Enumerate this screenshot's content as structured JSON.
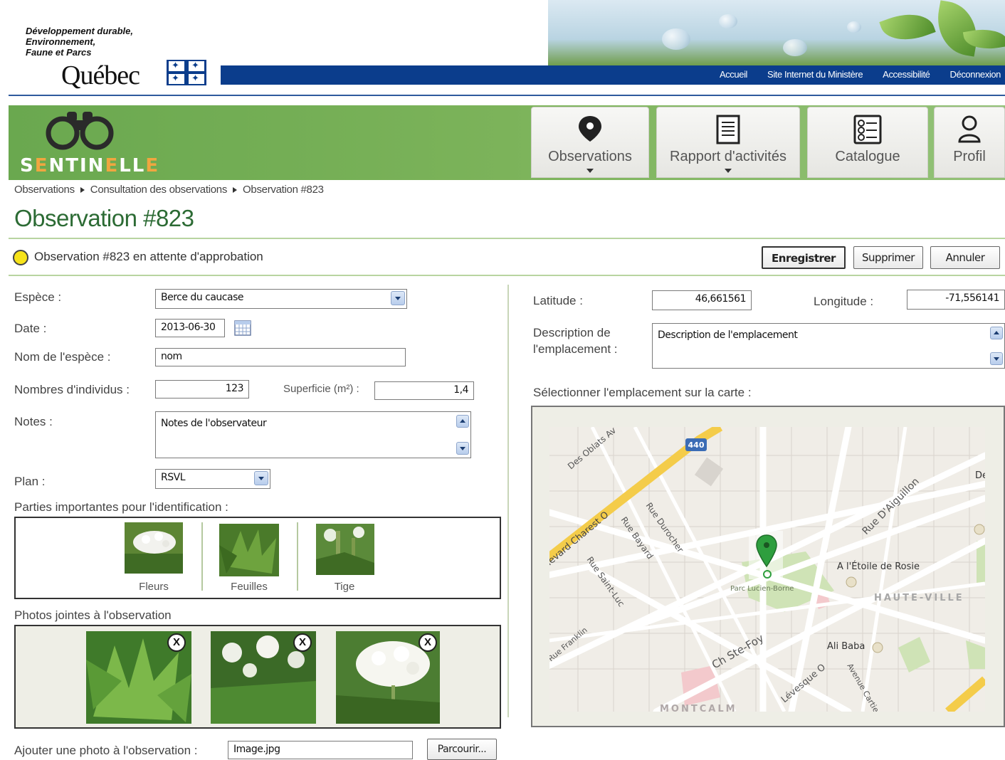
{
  "header": {
    "ministry_lines": [
      "Développement durable,",
      "Environnement,",
      "Faune et Parcs"
    ],
    "government": "Québec",
    "links": [
      "Accueil",
      "Site Internet du Ministère",
      "Accessibilité",
      "Déconnexion"
    ]
  },
  "brand": {
    "prefix": "S",
    "highlight1": "E",
    "mid": "NTIN",
    "highlight2": "E",
    "suffix": "LL",
    "last": "E"
  },
  "nav": [
    {
      "label": "Observations",
      "icon": "map-pin-icon",
      "has_dropdown": true
    },
    {
      "label": "Rapport d'activités",
      "icon": "document-icon",
      "has_dropdown": true
    },
    {
      "label": "Catalogue",
      "icon": "catalogue-icon",
      "has_dropdown": false
    },
    {
      "label": "Profil",
      "icon": "user-icon",
      "has_dropdown": false
    }
  ],
  "breadcrumb": [
    "Observations",
    "Consultation des observations",
    "Observation #823"
  ],
  "page_title": "Observation #823",
  "status": {
    "text": "Observation #823 en attente d'approbation",
    "color": "#f7e31a"
  },
  "actions": {
    "save": "Enregistrer",
    "delete": "Supprimer",
    "cancel": "Annuler"
  },
  "form": {
    "species_label": "Espèce :",
    "species_value": "Berce du caucase",
    "date_label": "Date :",
    "date_value": "2013-06-30",
    "species_name_label": "Nom de l'espèce :",
    "species_name_value": "nom",
    "individuals_label": "Nombres d'individus :",
    "individuals_value": "123",
    "area_label": "Superficie (m²) :",
    "area_value": "1,4",
    "notes_label": "Notes :",
    "notes_value": "Notes de l'observateur",
    "plan_label": "Plan :",
    "plan_value": "RSVL",
    "parts_label": "Parties importantes pour l'identification :",
    "parts": [
      "Fleurs",
      "Feuilles",
      "Tige"
    ],
    "photos_label": "Photos jointes à l'observation",
    "add_photo_label": "Ajouter une photo à l'observation :",
    "add_photo_value": "Image.jpg",
    "browse": "Parcourir..."
  },
  "location": {
    "latitude_label": "Latitude :",
    "latitude_value": "46,661561",
    "longitude_label": "Longitude :",
    "longitude_value": "-71,556141",
    "description_label_1": "Description de",
    "description_label_2": "l'emplacement :",
    "description_value": "Description de l'emplacement",
    "map_label": "Sélectionner l'emplacement sur la carte :"
  },
  "map": {
    "streets": [
      "Des Oblats Av",
      "levard Charest O",
      "Rue Durocher",
      "Rue Bayard",
      "Rue Saint-Luc",
      "Rue Franklin",
      "Ch Ste-Foy",
      "Lévesque O",
      "Avenue Cartier",
      "Rue D'Aiguillon"
    ],
    "places": [
      "A l'Étoile de Rosie",
      "HAUTE-VILLE",
      "Parc Lucien-Borne",
      "Ali Baba",
      "MONTCALM",
      "De"
    ],
    "highway": "440",
    "colors": {
      "highway": "#f4cc4a",
      "park": "#c9e0b0",
      "marker": "#2e9e3e"
    }
  }
}
